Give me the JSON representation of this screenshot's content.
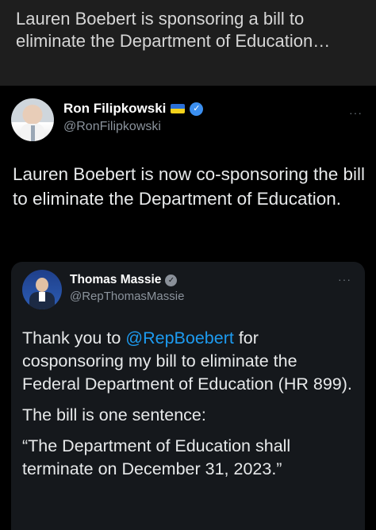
{
  "banner": {
    "headline": "Lauren Boebert is sponsoring a bill to eliminate the Department of Education…"
  },
  "tweet": {
    "author": {
      "display_name": "Ron Filipkowski",
      "handle": "@RonFilipkowski",
      "flag": "ukraine-flag-icon",
      "verified": true
    },
    "more_icon": "···",
    "text": "Lauren Boebert is now co-sponsoring the bill to eliminate the Department of Education."
  },
  "quoted_tweet": {
    "author": {
      "display_name": "Thomas Massie",
      "handle": "@RepThomasMassie",
      "verified": true
    },
    "more_icon": "···",
    "text_before_mention": "Thank you to ",
    "mention": "@RepBoebert",
    "text_after_mention": " for cosponsoring my bill to eliminate the Federal Department of Education (HR 899).",
    "paragraph_2": "The bill is one sentence:",
    "paragraph_3": "“The Department of Education shall terminate on December 31, 2023.”"
  },
  "colors": {
    "background": "#000000",
    "banner": "#1e1e1e",
    "quote_card": "#15181c",
    "link": "#1d9bf0",
    "verified_blue": "#3b8ff0"
  }
}
